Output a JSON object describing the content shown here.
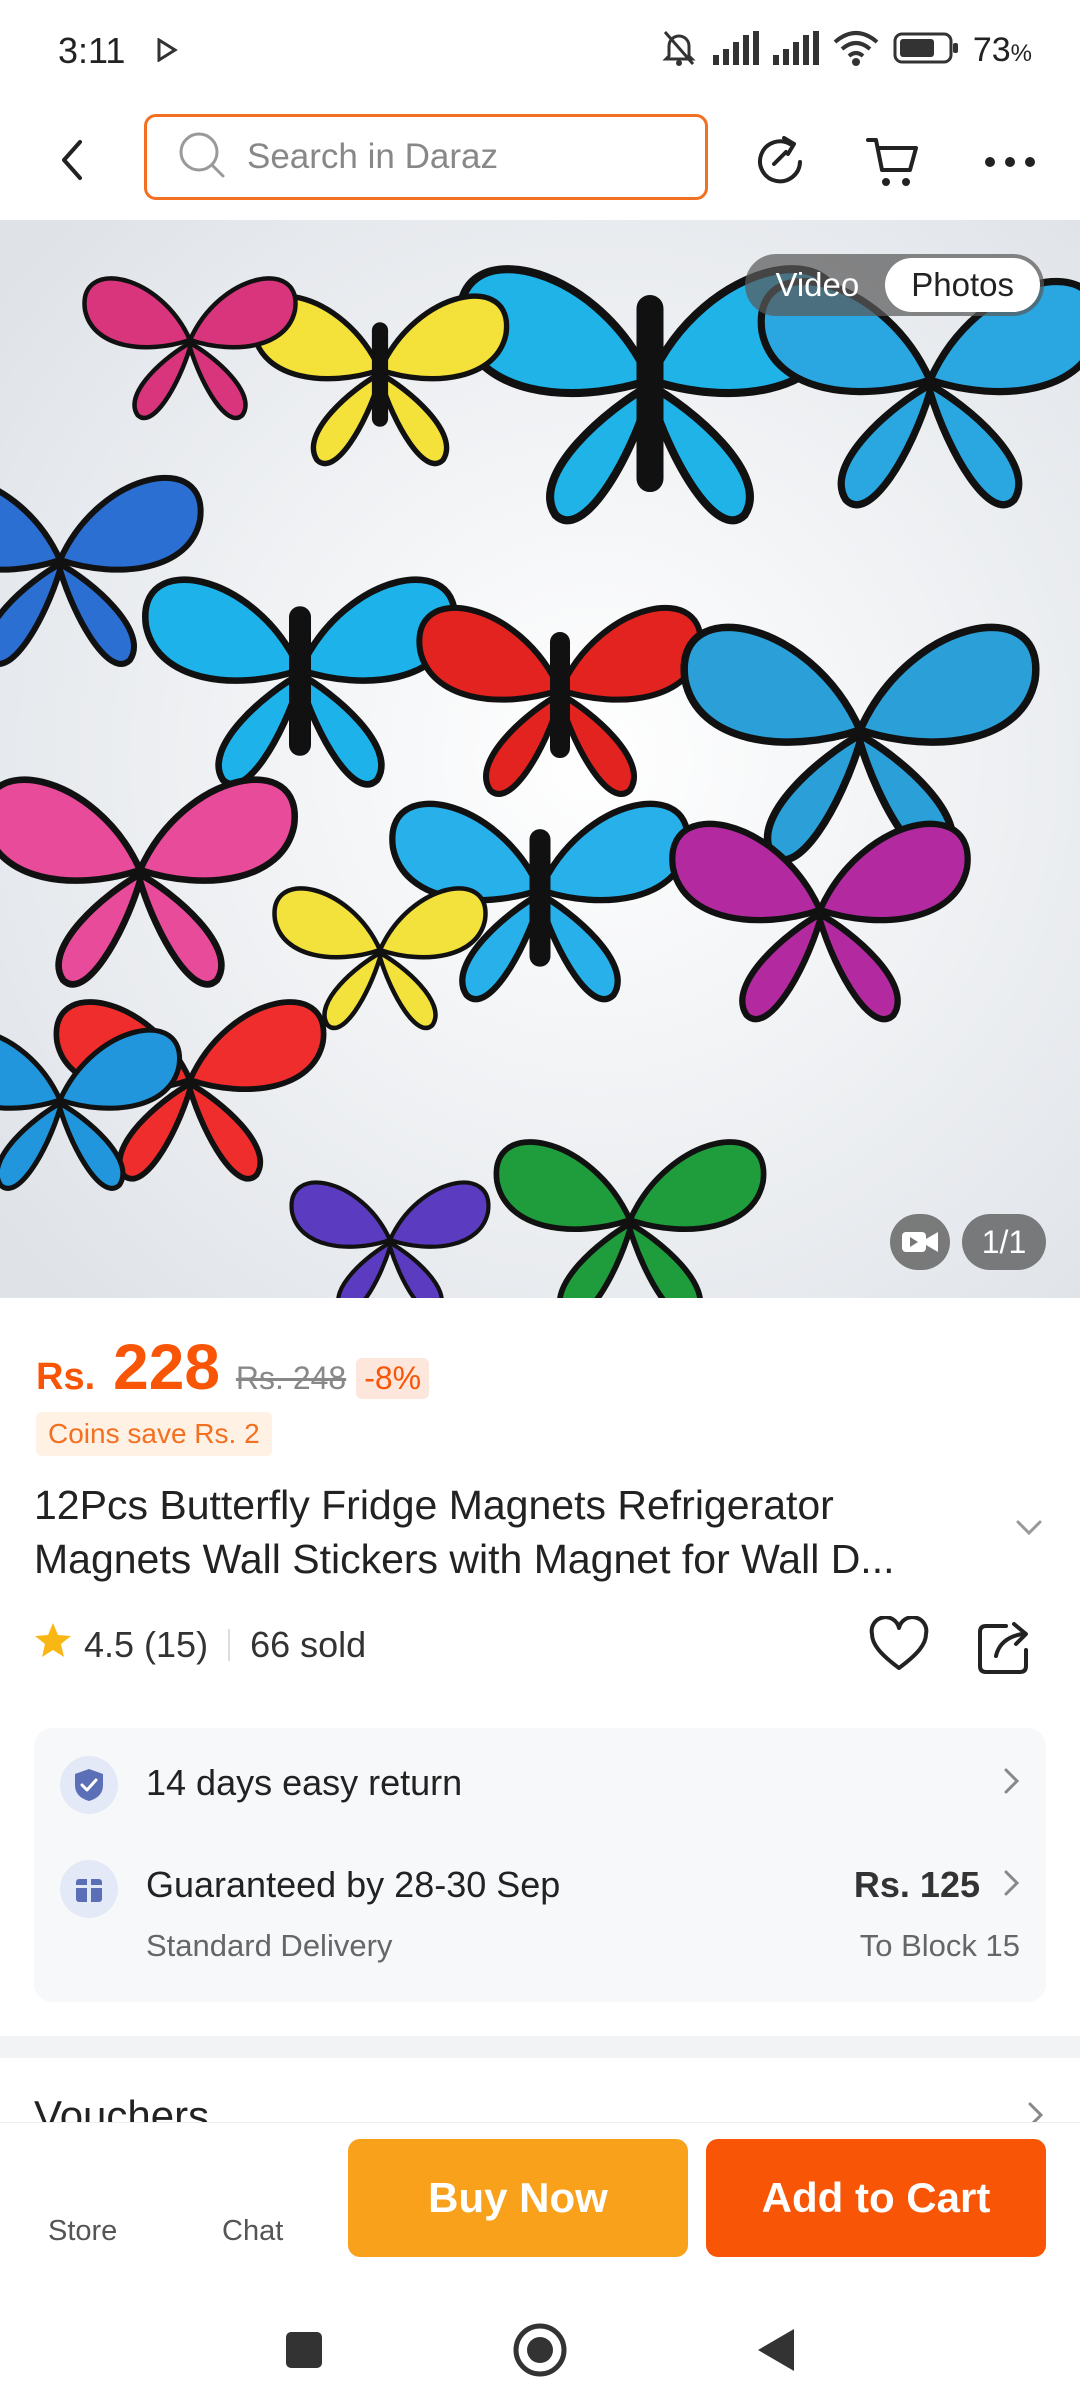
{
  "status_bar": {
    "time": "3:11",
    "battery_percent": "73",
    "battery_unit": "%"
  },
  "header": {
    "search_placeholder": "Search in Daraz",
    "icons": [
      "back-icon",
      "search-icon",
      "history-icon",
      "cart-icon",
      "more-icon"
    ]
  },
  "gallery": {
    "tabs": [
      {
        "label": "Video",
        "active": false
      },
      {
        "label": "Photos",
        "active": true
      }
    ],
    "image_counter": "1/1"
  },
  "product": {
    "currency": "Rs.",
    "price": "228",
    "original_price": "Rs. 248",
    "discount": "-8%",
    "coins_note": "Coins save Rs. 2",
    "title": "12Pcs Butterfly Fridge Magnets Refrigerator Magnets Wall Stickers with Magnet for Wall D...",
    "rating": "4.5",
    "review_count": "(15)",
    "sold": "66 sold"
  },
  "services": {
    "return_label": "14 days easy return",
    "delivery_label": "Guaranteed by 28-30 Sep",
    "delivery_type": "Standard Delivery",
    "delivery_price": "Rs. 125",
    "delivery_destination": "To Block 15"
  },
  "vouchers_label": "Vouchers",
  "action_bar": {
    "store_label": "Store",
    "chat_label": "Chat",
    "buy_now_label": "Buy Now",
    "add_to_cart_label": "Add to Cart"
  },
  "colors": {
    "brand_orange": "#f85606",
    "buy_now": "#f9a11b",
    "search_border": "#f36f21"
  }
}
